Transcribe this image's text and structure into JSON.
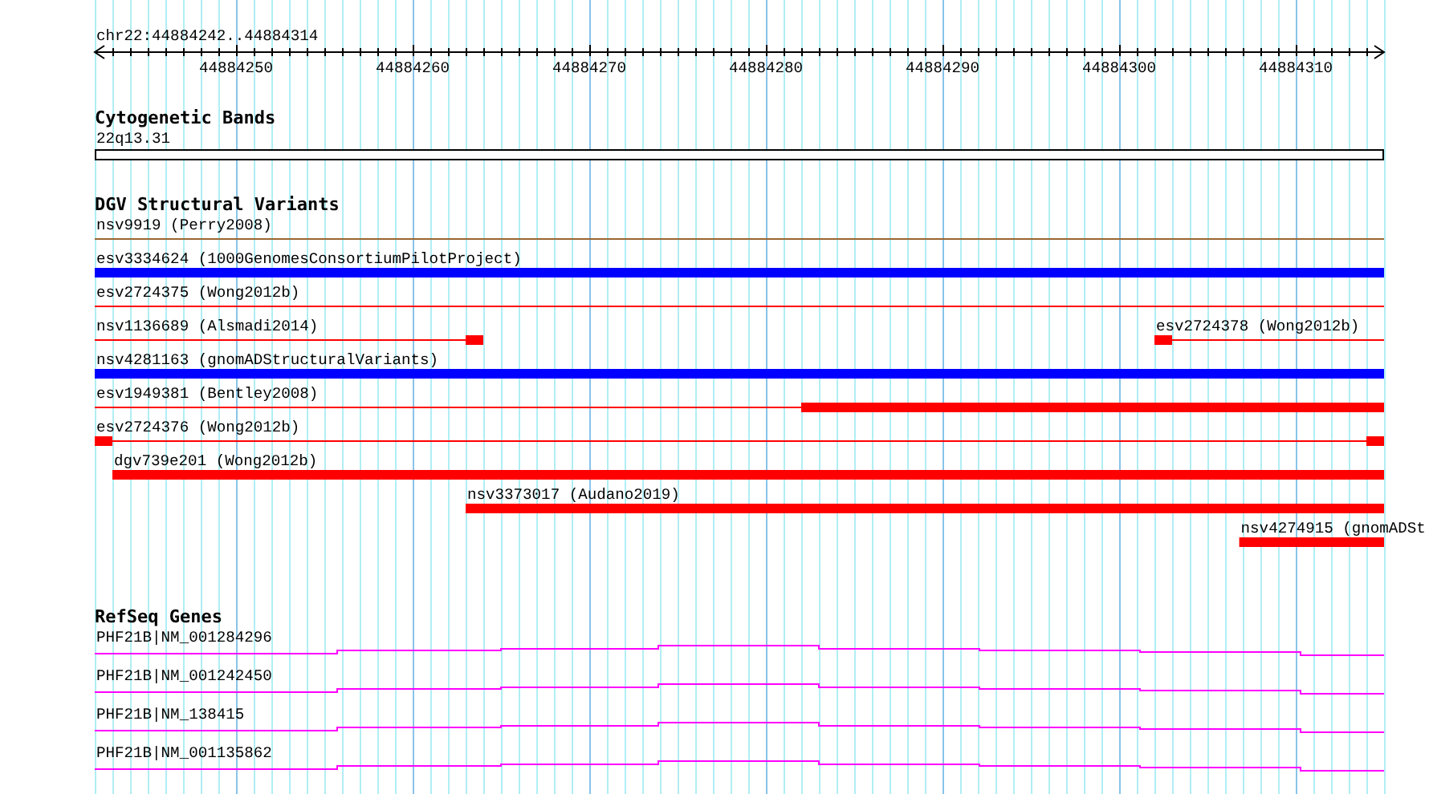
{
  "location": "chr22:44884242..44884314",
  "ruler": {
    "ticks": [
      "44884250",
      "44884260",
      "44884270",
      "44884280",
      "44884290",
      "44884300",
      "44884310"
    ]
  },
  "tracks": [
    {
      "kind": "cytoband",
      "title": "Cytogenetic Bands",
      "bands": [
        {
          "label": "22q13.31"
        }
      ]
    },
    {
      "kind": "variants",
      "title": "DGV Structural Variants",
      "rows": [
        {
          "features": [
            {
              "label": "nsv9919 (Perry2008)",
              "color": "#996633"
            }
          ]
        },
        {
          "features": [
            {
              "label": "esv3334624 (1000GenomesConsortiumPilotProject)",
              "color": "#0000ff"
            }
          ]
        },
        {
          "features": [
            {
              "label": "esv2724375 (Wong2012b)",
              "color": "#ff0000"
            }
          ]
        },
        {
          "features": [
            {
              "label": "nsv1136689 (Alsmadi2014)",
              "color": "#ff0000"
            },
            {
              "label": "esv2724378 (Wong2012b)",
              "color": "#ff0000"
            }
          ]
        },
        {
          "features": [
            {
              "label": "nsv4281163 (gnomADStructuralVariants)",
              "color": "#0000ff"
            }
          ]
        },
        {
          "features": [
            {
              "label": "esv1949381 (Bentley2008)",
              "color": "#ff0000"
            }
          ]
        },
        {
          "features": [
            {
              "label": "esv2724376 (Wong2012b)",
              "color": "#ff0000"
            }
          ]
        },
        {
          "features": [
            {
              "label": "dgv739e201 (Wong2012b)",
              "color": "#ff0000"
            }
          ]
        },
        {
          "features": [
            {
              "label": "nsv3373017 (Audano2019)",
              "color": "#ff0000"
            }
          ]
        },
        {
          "features": [
            {
              "label": "nsv4274915 (gnomADSt",
              "color": "#ff0000"
            }
          ]
        }
      ]
    },
    {
      "kind": "genes",
      "title": "RefSeq Genes",
      "genes": [
        {
          "label": "PHF21B|NM_001284296"
        },
        {
          "label": "PHF21B|NM_001242450"
        },
        {
          "label": "PHF21B|NM_138415"
        },
        {
          "label": "PHF21B|NM_001135862"
        }
      ]
    }
  ]
}
